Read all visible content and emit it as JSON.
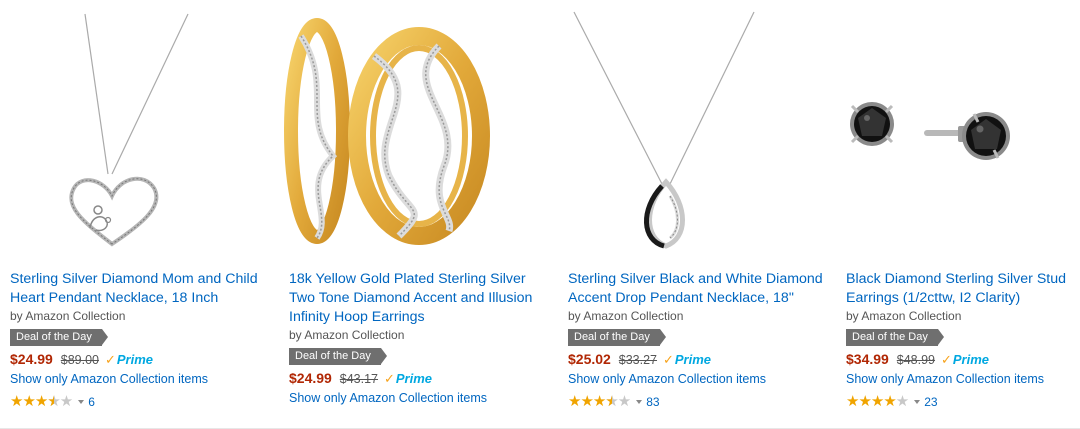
{
  "products": [
    {
      "title": "Sterling Silver Diamond Mom and Child Heart Pendant Necklace, 18 Inch",
      "byline": "by Amazon Collection",
      "badge": "Deal of the Day",
      "price": "$24.99",
      "list_price": "$89.00",
      "prime_label": "Prime",
      "show_only": "Show only Amazon Collection items",
      "rating_stars": 3.5,
      "review_count": "6",
      "image_icon": "heart-pendant-necklace"
    },
    {
      "title": "18k Yellow Gold Plated Sterling Silver Two Tone Diamond Accent and Illusion Infinity Hoop Earrings",
      "byline": "by Amazon Collection",
      "badge": "Deal of the Day",
      "price": "$24.99",
      "list_price": "$43.17",
      "prime_label": "Prime",
      "show_only": "Show only Amazon Collection items",
      "rating_stars": null,
      "review_count": "",
      "image_icon": "gold-hoop-earrings"
    },
    {
      "title": "Sterling Silver Black and White Diamond Accent Drop Pendant Necklace, 18\"",
      "byline": "by Amazon Collection",
      "badge": "Deal of the Day",
      "price": "$25.02",
      "list_price": "$33.27",
      "prime_label": "Prime",
      "show_only": "Show only Amazon Collection items",
      "rating_stars": 3.5,
      "review_count": "83",
      "image_icon": "drop-pendant-necklace"
    },
    {
      "title": "Black Diamond Sterling Silver Stud Earrings (1/2cttw, I2 Clarity)",
      "byline": "by Amazon Collection",
      "badge": "Deal of the Day",
      "price": "$34.99",
      "list_price": "$48.99",
      "prime_label": "Prime",
      "show_only": "Show only Amazon Collection items",
      "rating_stars": 4,
      "review_count": "23",
      "image_icon": "black-stud-earrings"
    }
  ],
  "colors": {
    "link": "#0066c0",
    "price": "#b12704",
    "badge_bg": "#6f6f6f",
    "star": "#f0a400",
    "prime": "#00a8e1"
  }
}
